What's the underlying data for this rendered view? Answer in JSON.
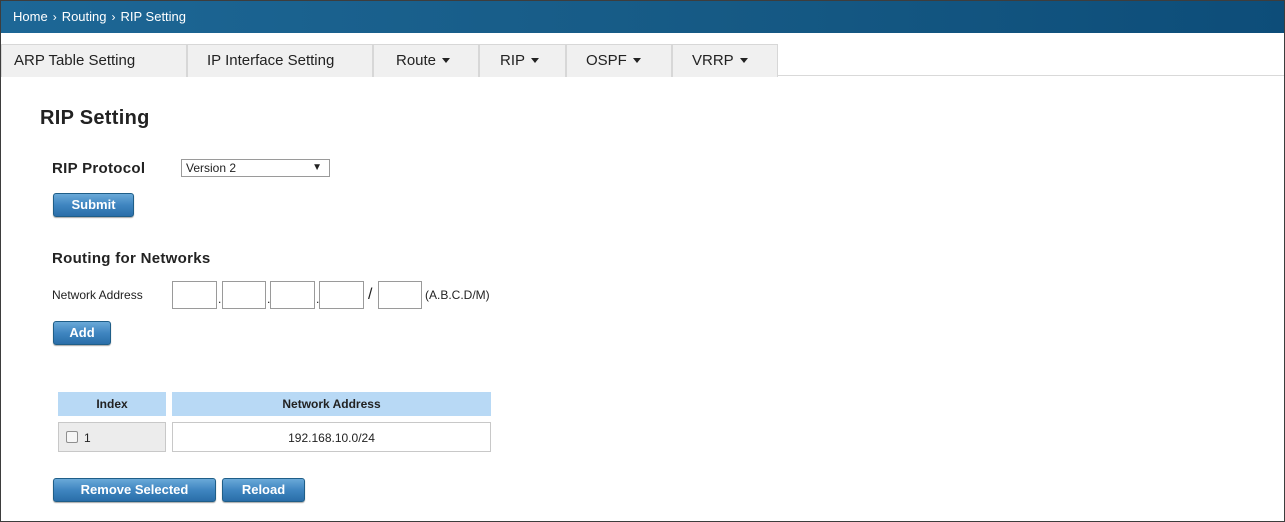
{
  "breadcrumb": [
    "Home",
    "Routing",
    "RIP Setting"
  ],
  "breadcrumb_separator": "›",
  "tabs": [
    {
      "label": "ARP Table Setting",
      "dropdown": false
    },
    {
      "label": "IP Interface Setting",
      "dropdown": false
    },
    {
      "label": "Route",
      "dropdown": true
    },
    {
      "label": "RIP",
      "dropdown": true
    },
    {
      "label": "OSPF",
      "dropdown": true
    },
    {
      "label": "VRRP",
      "dropdown": true
    }
  ],
  "page_title": "RIP Setting",
  "rip_protocol": {
    "label": "RIP Protocol",
    "selected": "Version 2",
    "arrow": "▼"
  },
  "submit_label": "Submit",
  "routing": {
    "title": "Routing for Networks",
    "network_label": "Network Address",
    "octets": [
      "",
      "",
      "",
      ""
    ],
    "mask": "",
    "dot": ".",
    "slash": "/",
    "format_hint": "(A.B.C.D/M)",
    "add_label": "Add"
  },
  "table": {
    "headers": {
      "index": "Index",
      "address": "Network Address"
    },
    "rows": [
      {
        "index": "1",
        "address": "192.168.10.0/24",
        "checked": false
      }
    ]
  },
  "remove_label": "Remove Selected",
  "reload_label": "Reload",
  "colors": {
    "breadcrumb_bar": "#165a85",
    "button": "#3f85c0",
    "table_header": "#b8d9f5"
  }
}
